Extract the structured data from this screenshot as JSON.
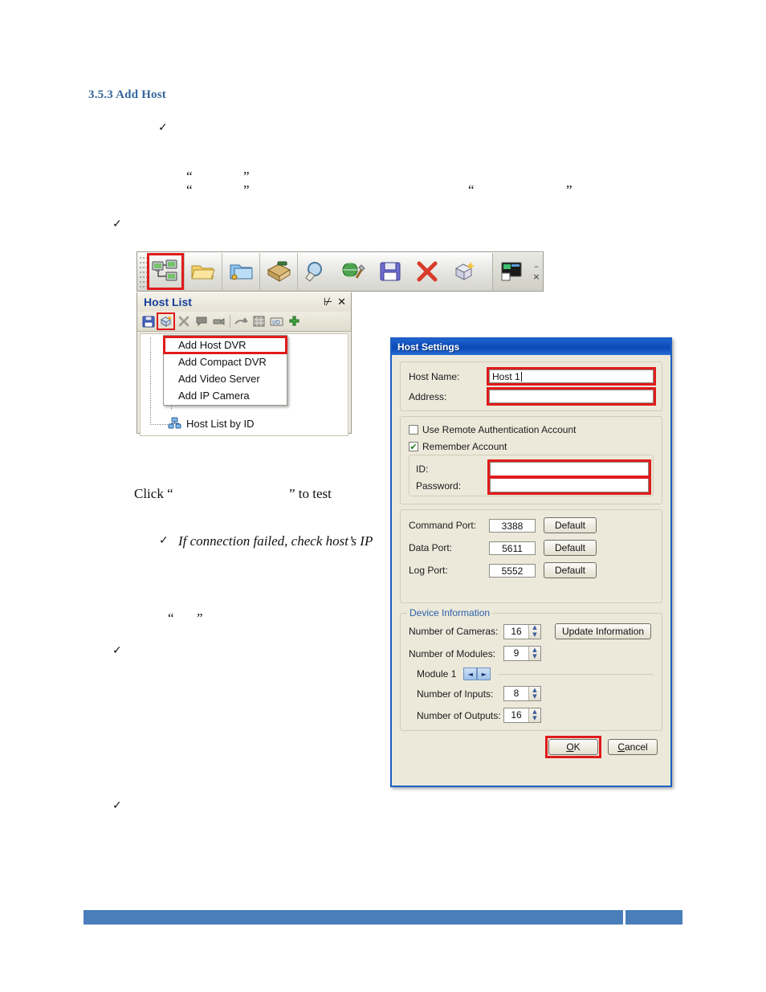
{
  "document": {
    "heading": "3.5.3 Add Host",
    "check_glyph": "✓",
    "open_quote": "“",
    "close_quote": "”",
    "click_prefix": "Click “",
    "click_suffix": "” to test",
    "note_italic": "If connection failed, check host’s IP"
  },
  "app_toolbar": {
    "buttons": [
      {
        "name": "host-list-icon",
        "selected": true
      },
      {
        "name": "open-folder-icon",
        "selected": false
      },
      {
        "name": "blue-folder-icon",
        "selected": false
      },
      {
        "name": "archive-book-icon",
        "selected": false
      },
      {
        "name": "search-magnifier-icon",
        "selected": false
      },
      {
        "name": "globe-tools-icon",
        "selected": false
      },
      {
        "name": "save-floppy-icon",
        "selected": false
      },
      {
        "name": "delete-x-icon",
        "selected": false
      },
      {
        "name": "new-box-icon",
        "selected": false
      },
      {
        "name": "display-screen-icon",
        "selected": false
      }
    ],
    "minimize_label": "–",
    "close_label": "×"
  },
  "host_list": {
    "title": "Host List",
    "pin_icon": "⊬",
    "close_icon": "✕",
    "toolbar_buttons": [
      "save-icon",
      "add-host-icon",
      "delete-icon",
      "message-icon",
      "camera-icon",
      "connector-icon",
      "grid-icon",
      "io-icon",
      "add-green-icon"
    ],
    "tree_item": "Host List by ID"
  },
  "context_menu": {
    "items": [
      {
        "label": "Add Host DVR",
        "highlighted": true
      },
      {
        "label": "Add Compact DVR",
        "highlighted": false
      },
      {
        "label": "Add Video Server",
        "highlighted": false
      },
      {
        "label": "Add IP Camera",
        "highlighted": false
      }
    ]
  },
  "dialog": {
    "title": "Host Settings",
    "host_name_label": "Host Name:",
    "host_name_value": "Host 1",
    "address_label": "Address:",
    "address_value": "",
    "use_remote_auth_label": "Use Remote Authentication Account",
    "use_remote_auth_checked": false,
    "remember_account_label": "Remember Account",
    "remember_account_checked": true,
    "remember_account_check_glyph": "✔",
    "id_label": "ID:",
    "id_value": "",
    "password_label": "Password:",
    "password_value": "",
    "ports": [
      {
        "label": "Command Port:",
        "value": "3388",
        "button": "Default"
      },
      {
        "label": "Data Port:",
        "value": "5611",
        "button": "Default"
      },
      {
        "label": "Log Port:",
        "value": "5552",
        "button": "Default"
      }
    ],
    "device_info": {
      "legend": "Device Information",
      "cameras_label": "Number of Cameras:",
      "cameras_value": "16",
      "update_button": "Update Information",
      "modules_label": "Number of Modules:",
      "modules_value": "9",
      "module_label": "Module 1",
      "prev_arrow": "◄",
      "next_arrow": "►",
      "inputs_label": "Number of Inputs:",
      "inputs_value": "8",
      "outputs_label": "Number of Outputs:",
      "outputs_value": "16"
    },
    "ok_button": "OK",
    "ok_accel": "O",
    "cancel_button": "Cancel",
    "cancel_accel": "C"
  },
  "colors": {
    "heading_blue": "#34679A",
    "highlight_red": "#E01B1B",
    "dialog_bg": "#ECE9DB",
    "titlebar_blue": "#0A48B6",
    "footer_blue": "#4A7EBB",
    "panel_title_blue": "#16409B"
  }
}
